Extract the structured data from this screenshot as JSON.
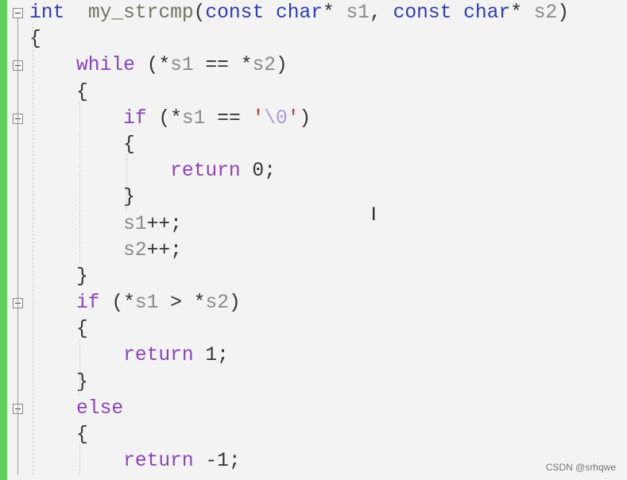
{
  "editor": {
    "accent_bar_color": "#5fcf5f",
    "lines": [
      {
        "indent": 0,
        "fold": true,
        "tokens": [
          [
            "kw",
            "int"
          ],
          [
            "",
            "  "
          ],
          [
            "fn",
            "my_strcmp"
          ],
          [
            "",
            "("
          ],
          [
            "kw",
            "const"
          ],
          [
            "",
            " "
          ],
          [
            "kw",
            "char"
          ],
          [
            "",
            "* "
          ],
          [
            "id",
            "s1"
          ],
          [
            "",
            ", "
          ],
          [
            "kw",
            "const"
          ],
          [
            "",
            " "
          ],
          [
            "kw",
            "char"
          ],
          [
            "",
            "* "
          ],
          [
            "id",
            "s2"
          ],
          [
            "",
            ")"
          ]
        ]
      },
      {
        "indent": 0,
        "tokens": [
          [
            "",
            "{"
          ]
        ]
      },
      {
        "indent": 1,
        "fold": true,
        "tokens": [
          [
            "ctl",
            "while"
          ],
          [
            "",
            " (*"
          ],
          [
            "id",
            "s1"
          ],
          [
            "",
            " == *"
          ],
          [
            "id",
            "s2"
          ],
          [
            "",
            ")"
          ]
        ]
      },
      {
        "indent": 1,
        "tokens": [
          [
            "",
            "{"
          ]
        ]
      },
      {
        "indent": 2,
        "fold": true,
        "tokens": [
          [
            "ctl",
            "if"
          ],
          [
            "",
            " (*"
          ],
          [
            "id",
            "s1"
          ],
          [
            "",
            " == "
          ],
          [
            "str",
            "'"
          ],
          [
            "esc",
            "\\0"
          ],
          [
            "str",
            "'"
          ],
          [
            "",
            ")"
          ]
        ]
      },
      {
        "indent": 2,
        "tokens": [
          [
            "",
            "{"
          ]
        ]
      },
      {
        "indent": 3,
        "tokens": [
          [
            "ctl",
            "return"
          ],
          [
            "",
            " 0;"
          ]
        ]
      },
      {
        "indent": 2,
        "tokens": [
          [
            "",
            "}"
          ]
        ]
      },
      {
        "indent": 2,
        "tokens": [
          [
            "id",
            "s1"
          ],
          [
            "",
            "++;"
          ]
        ]
      },
      {
        "indent": 2,
        "tokens": [
          [
            "id",
            "s2"
          ],
          [
            "",
            "++;"
          ]
        ]
      },
      {
        "indent": 1,
        "tokens": [
          [
            "",
            "}"
          ]
        ]
      },
      {
        "indent": 1,
        "fold": true,
        "tokens": [
          [
            "ctl",
            "if"
          ],
          [
            "",
            " (*"
          ],
          [
            "id",
            "s1"
          ],
          [
            "",
            " > *"
          ],
          [
            "id",
            "s2"
          ],
          [
            "",
            ")"
          ]
        ]
      },
      {
        "indent": 1,
        "tokens": [
          [
            "",
            "{"
          ]
        ]
      },
      {
        "indent": 2,
        "tokens": [
          [
            "ctl",
            "return"
          ],
          [
            "",
            " 1;"
          ]
        ]
      },
      {
        "indent": 1,
        "tokens": [
          [
            "",
            "}"
          ]
        ]
      },
      {
        "indent": 1,
        "fold": true,
        "tokens": [
          [
            "ctl",
            "else"
          ]
        ]
      },
      {
        "indent": 1,
        "tokens": [
          [
            "",
            "{"
          ]
        ]
      },
      {
        "indent": 2,
        "tokens": [
          [
            "ctl",
            "return"
          ],
          [
            "",
            " -1;"
          ]
        ]
      }
    ]
  },
  "watermark": "CSDN @srhqwe",
  "cursor_icon": "text-cursor-icon"
}
